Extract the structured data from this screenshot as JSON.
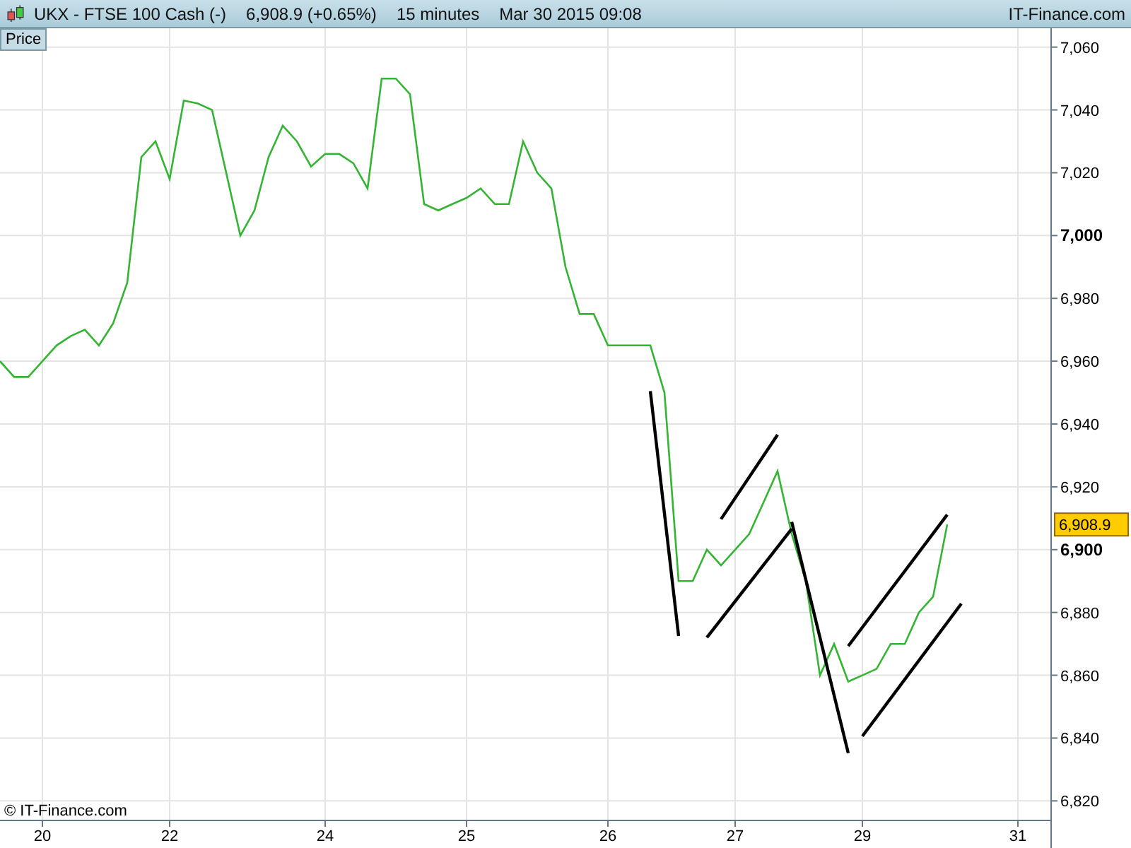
{
  "header": {
    "symbol": "UKX - FTSE 100 Cash (-)",
    "quote": "6,908.9 (+0.65%)",
    "interval": "15 minutes",
    "datetime": "Mar 30 2015 09:08",
    "brand": "IT-Finance.com"
  },
  "price_tab": "Price",
  "last_price": {
    "label": "6,908.9"
  },
  "copyright": "© IT-Finance.com",
  "chart": {
    "chart_data": {
      "type": "line",
      "categories": [
        null,
        null,
        null,
        "20",
        null,
        null,
        null,
        null,
        null,
        null,
        null,
        null,
        "22",
        null,
        null,
        null,
        null,
        null,
        null,
        null,
        null,
        null,
        null,
        "24",
        null,
        null,
        null,
        null,
        null,
        null,
        null,
        null,
        null,
        "25",
        null,
        null,
        null,
        null,
        null,
        null,
        null,
        null,
        null,
        "26",
        null,
        null,
        null,
        null,
        null,
        null,
        null,
        null,
        "27",
        null,
        null,
        null,
        null,
        null,
        null,
        null,
        null,
        "29",
        null,
        null,
        null,
        null,
        null,
        null,
        null,
        null,
        null,
        null,
        "31",
        null,
        null
      ],
      "series": [
        {
          "color": "#33b533",
          "values": [
            6960,
            6955,
            6955,
            6960,
            6965,
            6968,
            6970,
            6965,
            6972,
            6985,
            7025,
            7030,
            7018,
            7043,
            7042,
            7040,
            7020,
            7000,
            7008,
            7025,
            7035,
            7030,
            7022,
            7026,
            7026,
            7023,
            7015,
            7050,
            7050,
            7045,
            7010,
            7008,
            7010,
            7012,
            7015,
            7010,
            7010,
            7030,
            7020,
            7015,
            6990,
            6975,
            6975,
            6965,
            6965,
            6965,
            6965,
            6950,
            6890,
            6890,
            6900,
            6895,
            6900,
            6905,
            6915,
            6925,
            6905,
            6890,
            6860,
            6870,
            6858,
            6860,
            6862,
            6870,
            6870,
            6880,
            6885,
            6908,
            null,
            null,
            null,
            null,
            null,
            null,
            null
          ]
        },
        {
          "color": "#000000",
          "values": [
            null,
            null,
            null,
            null,
            null,
            null,
            null,
            null,
            null,
            null,
            null,
            null,
            null,
            null,
            null,
            null,
            null,
            null,
            null,
            null,
            null,
            null,
            null,
            null,
            null,
            null,
            null,
            null,
            null,
            null,
            null,
            null,
            null,
            null,
            null,
            null,
            null,
            null,
            null,
            null,
            null,
            null,
            null,
            null,
            null,
            null,
            6950.5,
            null,
            6872.5,
            null,
            null,
            null,
            null,
            null,
            null,
            null,
            null,
            null,
            null,
            null,
            null,
            null,
            null,
            null,
            null,
            null,
            null,
            null,
            null,
            null,
            null,
            null,
            null,
            null,
            null
          ]
        },
        {
          "color": "#000000",
          "values": [
            null,
            null,
            null,
            null,
            null,
            null,
            null,
            null,
            null,
            null,
            null,
            null,
            null,
            null,
            null,
            null,
            null,
            null,
            null,
            null,
            null,
            null,
            null,
            null,
            null,
            null,
            null,
            null,
            null,
            null,
            null,
            null,
            null,
            null,
            null,
            null,
            null,
            null,
            null,
            null,
            null,
            null,
            null,
            null,
            null,
            null,
            null,
            null,
            null,
            null,
            null,
            6909.7,
            null,
            null,
            null,
            6936.6,
            null,
            null,
            null,
            null,
            null,
            null,
            null,
            null,
            null,
            null,
            null,
            null,
            null,
            null,
            null,
            null,
            null,
            null,
            null
          ]
        },
        {
          "color": "#000000",
          "values": [
            null,
            null,
            null,
            null,
            null,
            null,
            null,
            null,
            null,
            null,
            null,
            null,
            null,
            null,
            null,
            null,
            null,
            null,
            null,
            null,
            null,
            null,
            null,
            null,
            null,
            null,
            null,
            null,
            null,
            null,
            null,
            null,
            null,
            null,
            null,
            null,
            null,
            null,
            null,
            null,
            null,
            null,
            null,
            null,
            null,
            null,
            null,
            null,
            null,
            null,
            6872,
            null,
            null,
            null,
            null,
            null,
            6906.6,
            null,
            null,
            null,
            null,
            null,
            null,
            null,
            null,
            null,
            null,
            null,
            null,
            null,
            null,
            null,
            null,
            null,
            null
          ]
        },
        {
          "color": "#000000",
          "values": [
            null,
            null,
            null,
            null,
            null,
            null,
            null,
            null,
            null,
            null,
            null,
            null,
            null,
            null,
            null,
            null,
            null,
            null,
            null,
            null,
            null,
            null,
            null,
            null,
            null,
            null,
            null,
            null,
            null,
            null,
            null,
            null,
            null,
            null,
            null,
            null,
            null,
            null,
            null,
            null,
            null,
            null,
            null,
            null,
            null,
            null,
            null,
            null,
            null,
            null,
            null,
            null,
            null,
            null,
            null,
            null,
            6908.8,
            null,
            null,
            null,
            6835.2,
            null,
            null,
            null,
            null,
            null,
            null,
            null,
            null,
            null,
            null,
            null,
            null,
            null,
            null
          ]
        },
        {
          "color": "#000000",
          "values": [
            null,
            null,
            null,
            null,
            null,
            null,
            null,
            null,
            null,
            null,
            null,
            null,
            null,
            null,
            null,
            null,
            null,
            null,
            null,
            null,
            null,
            null,
            null,
            null,
            null,
            null,
            null,
            null,
            null,
            null,
            null,
            null,
            null,
            null,
            null,
            null,
            null,
            null,
            null,
            null,
            null,
            null,
            null,
            null,
            null,
            null,
            null,
            null,
            null,
            null,
            null,
            null,
            null,
            null,
            null,
            null,
            null,
            null,
            null,
            null,
            6869.3,
            null,
            null,
            null,
            null,
            null,
            null,
            6911.1,
            null,
            null,
            null,
            null,
            null,
            null,
            null
          ]
        },
        {
          "color": "#000000",
          "values": [
            null,
            null,
            null,
            null,
            null,
            null,
            null,
            null,
            null,
            null,
            null,
            null,
            null,
            null,
            null,
            null,
            null,
            null,
            null,
            null,
            null,
            null,
            null,
            null,
            null,
            null,
            null,
            null,
            null,
            null,
            null,
            null,
            null,
            null,
            null,
            null,
            null,
            null,
            null,
            null,
            null,
            null,
            null,
            null,
            null,
            null,
            null,
            null,
            null,
            null,
            null,
            null,
            null,
            null,
            null,
            null,
            null,
            null,
            null,
            null,
            null,
            6840.6,
            null,
            null,
            null,
            null,
            null,
            null,
            6882.8,
            null,
            null,
            null,
            null,
            null,
            null
          ]
        }
      ],
      "ylim": [
        6814,
        7066
      ],
      "grid": true,
      "yticks": [
        {
          "value": 6820,
          "label": "6,820"
        },
        {
          "value": 6840,
          "label": "6,840"
        },
        {
          "value": 6860,
          "label": "6,860"
        },
        {
          "value": 6880,
          "label": "6,880"
        },
        {
          "value": 6900,
          "label": "6,900"
        },
        {
          "value": 6920,
          "label": "6,920"
        },
        {
          "value": 6940,
          "label": "6,940"
        },
        {
          "value": 6960,
          "label": "6,960"
        },
        {
          "value": 6980,
          "label": "6,980"
        },
        {
          "value": 7000,
          "label": "7,000"
        },
        {
          "value": 7020,
          "label": "7,020"
        },
        {
          "value": 7040,
          "label": "7,040"
        },
        {
          "value": 7060,
          "label": "7,060"
        }
      ]
    }
  }
}
